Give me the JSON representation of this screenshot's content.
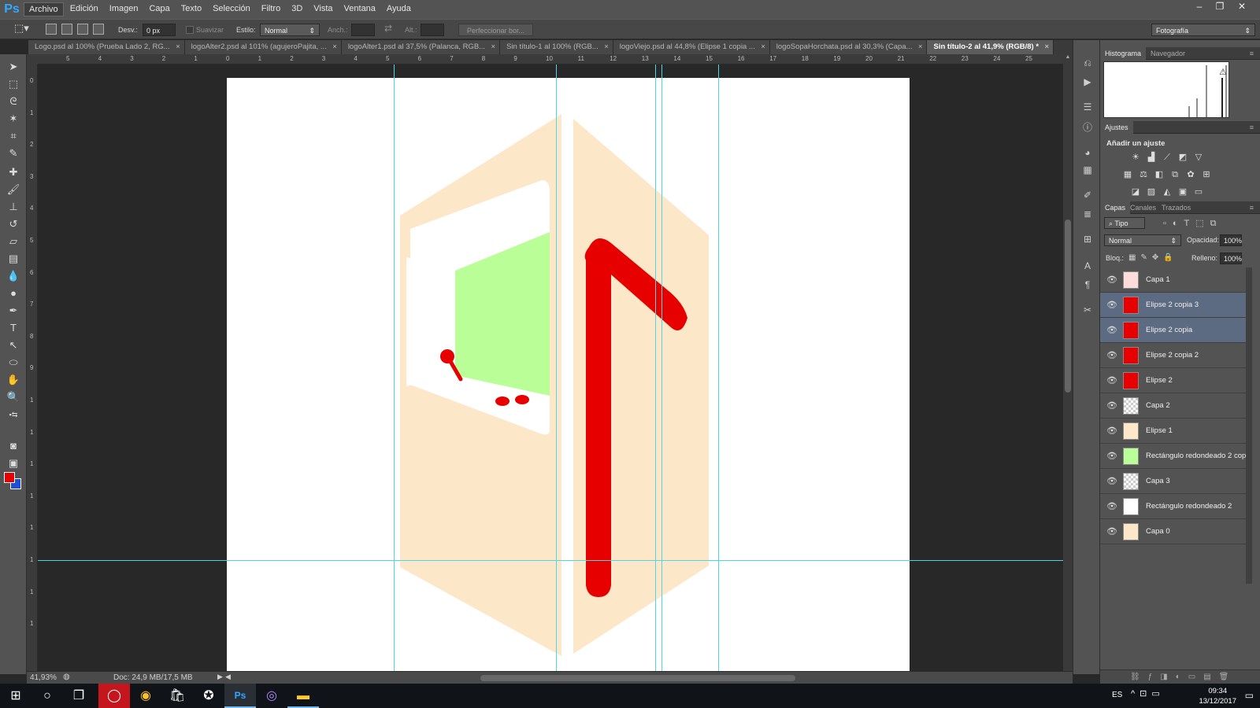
{
  "app": {
    "logo": "Ps"
  },
  "menu": [
    "Archivo",
    "Edición",
    "Imagen",
    "Capa",
    "Texto",
    "Selección",
    "Filtro",
    "3D",
    "Vista",
    "Ventana",
    "Ayuda"
  ],
  "window_controls": [
    "–",
    "❐",
    "✕"
  ],
  "options": {
    "feather_label": "Desv.:",
    "feather_value": "0 px",
    "smooth_label": "Suavizar",
    "style_label": "Estilo:",
    "style_value": "Normal",
    "width_label": "Anch.:",
    "height_label": "Alt.:",
    "refine_button": "Perfeccionar bor...",
    "workspace": "Fotografía"
  },
  "tabs": [
    {
      "label": "Logo.psd al 100% (Prueba Lado 2, RG...",
      "active": false
    },
    {
      "label": "logoAlter2.psd al 101% (agujeroPajita, ...",
      "active": false
    },
    {
      "label": "logoAlter1.psd al 37,5% (Palanca, RGB...",
      "active": false
    },
    {
      "label": "Sin título-1 al 100% (RGB...",
      "active": false
    },
    {
      "label": "logoViejo.psd al 44,8% (Elipse 1 copia ...",
      "active": false
    },
    {
      "label": "logoSopaHorchata.psd al 30,3% (Capa...",
      "active": false
    },
    {
      "label": "Sin título-2 al 41,9% (RGB/8) *",
      "active": true
    }
  ],
  "rulers": {
    "h_labels": [
      "5",
      "4",
      "3",
      "2",
      "1",
      "0",
      "1",
      "2",
      "3",
      "4",
      "5",
      "6",
      "7",
      "8",
      "9",
      "10",
      "11",
      "12",
      "13",
      "14",
      "15",
      "16",
      "17",
      "18",
      "19",
      "20",
      "21",
      "22",
      "23",
      "24",
      "25"
    ],
    "v_labels": [
      "0",
      "1",
      "2",
      "3",
      "4",
      "5",
      "6",
      "7",
      "8",
      "9",
      "1",
      "1",
      "1",
      "1",
      "1",
      "1",
      "1",
      "1"
    ]
  },
  "status": {
    "zoom": "41,93%",
    "doc": "Doc: 24,9 MB/17,5 MB"
  },
  "panels": {
    "top_tabs": [
      "Histograma",
      "Navegador"
    ],
    "adjust_tab": "Ajustes",
    "adjust_title": "Añadir un ajuste",
    "layer_tabs": [
      "Capas",
      "Canales",
      "Trazados"
    ],
    "kind_filter": "Tipo",
    "blend_mode": "Normal",
    "opacity_label": "Opacidad:",
    "opacity_value": "100%",
    "lock_label": "Bloq.:",
    "fill_label": "Relleno:",
    "fill_value": "100%"
  },
  "layers": [
    {
      "name": "Capa 1",
      "selected": false,
      "thumb": "#ffdcdc"
    },
    {
      "name": "Elipse 2 copia 3",
      "selected": true,
      "thumb": "#e60000"
    },
    {
      "name": "Elipse 2 copia",
      "selected": true,
      "thumb": "#e60000"
    },
    {
      "name": "Elipse 2 copia 2",
      "selected": false,
      "thumb": "#e60000"
    },
    {
      "name": "Elipse 2",
      "selected": false,
      "thumb": "#e60000"
    },
    {
      "name": "Capa 2",
      "selected": false,
      "thumb": ""
    },
    {
      "name": "Elipse 1",
      "selected": false,
      "thumb": "#fce7c8"
    },
    {
      "name": "Rectángulo redondeado 2 copia",
      "selected": false,
      "thumb": "#b9fe96"
    },
    {
      "name": "Capa 3",
      "selected": false,
      "thumb": ""
    },
    {
      "name": "Rectángulo redondeado 2",
      "selected": false,
      "thumb": "#ffffff"
    },
    {
      "name": "Capa 0",
      "selected": false,
      "thumb": "#fce7c8"
    }
  ],
  "taskbar": {
    "lang": "ES",
    "time": "09:34",
    "date": "13/12/2017"
  },
  "colors": {
    "foreground": "#e60000",
    "background": "#1f4fd6",
    "artwork_peach": "#fce7c8",
    "artwork_red": "#e60000",
    "artwork_green": "#b9fe96",
    "guide": "#4fd6e6"
  }
}
